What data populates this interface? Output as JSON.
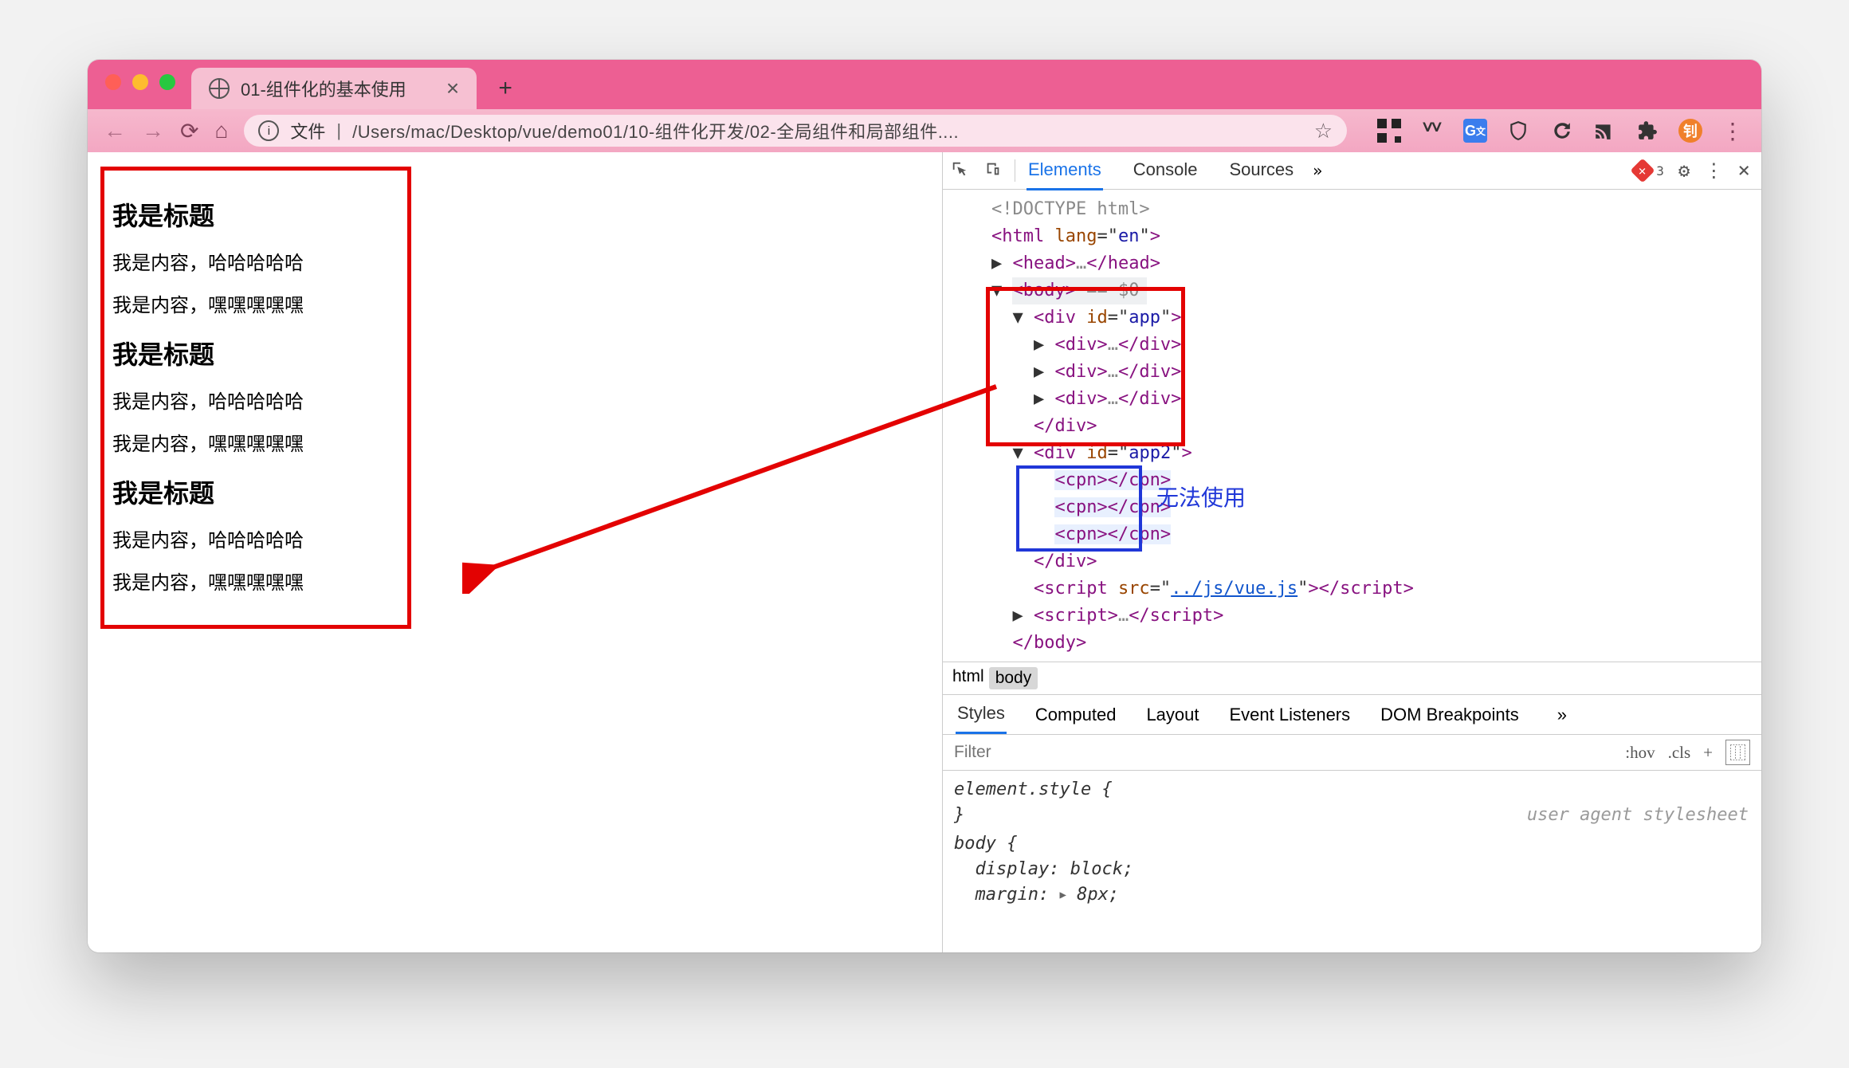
{
  "window": {
    "tab_title": "01-组件化的基本使用",
    "url_prefix": "文件",
    "url_path": "/Users/mac/Desktop/vue/demo01/10-组件化开发/02-全局组件和局部组件....",
    "avatar_initial": "钊"
  },
  "page": {
    "blocks": [
      {
        "title": "我是标题",
        "lines": [
          "我是内容，哈哈哈哈哈",
          "我是内容，嘿嘿嘿嘿嘿"
        ]
      },
      {
        "title": "我是标题",
        "lines": [
          "我是内容，哈哈哈哈哈",
          "我是内容，嘿嘿嘿嘿嘿"
        ]
      },
      {
        "title": "我是标题",
        "lines": [
          "我是内容，哈哈哈哈哈",
          "我是内容，嘿嘿嘿嘿嘿"
        ]
      }
    ]
  },
  "devtools": {
    "tabs": [
      "Elements",
      "Console",
      "Sources"
    ],
    "active_tab": "Elements",
    "error_count": "3",
    "dom_lines": [
      {
        "indent": 0,
        "pre": "",
        "html": "<span class='gray'>&lt;!DOCTYPE html&gt;</span>"
      },
      {
        "indent": 0,
        "pre": "",
        "html": "<span class='tag-p'>&lt;html</span> <span class='tag-a'>lang</span>=\"<span class='tag-v'>en</span>\"<span class='tag-p'>&gt;</span>"
      },
      {
        "indent": 1,
        "pre": "▶",
        "html": "<span class='tag-p'>&lt;head&gt;</span><span class='gray'>…</span><span class='tag-p'>&lt;/head&gt;</span>"
      },
      {
        "indent": 1,
        "pre": "▼",
        "html": "<span class='bodyhl'><span class='tag-p'>&lt;body&gt;</span> <span class='gray'>== $0</span></span>",
        "dots": true
      },
      {
        "indent": 2,
        "pre": "▼",
        "html": "<span class='tag-p'>&lt;div</span> <span class='tag-a'>id</span>=\"<span class='tag-v'>app</span>\"<span class='tag-p'>&gt;</span>"
      },
      {
        "indent": 3,
        "pre": "▶",
        "html": "<span class='tag-p'>&lt;div&gt;</span><span class='gray'>…</span><span class='tag-p'>&lt;/div&gt;</span>"
      },
      {
        "indent": 3,
        "pre": "▶",
        "html": "<span class='tag-p'>&lt;div&gt;</span><span class='gray'>…</span><span class='tag-p'>&lt;/div&gt;</span>"
      },
      {
        "indent": 3,
        "pre": "▶",
        "html": "<span class='tag-p'>&lt;div&gt;</span><span class='gray'>…</span><span class='tag-p'>&lt;/div&gt;</span>"
      },
      {
        "indent": 2,
        "pre": "",
        "html": "<span class='tag-p'>&lt;/div&gt;</span>"
      },
      {
        "indent": 2,
        "pre": "▼",
        "html": "<span class='tag-p'>&lt;div</span> <span class='tag-a'>id</span>=\"<span class='tag-v'>app2</span>\"<span class='tag-p'>&gt;</span>"
      },
      {
        "indent": 3,
        "pre": "",
        "html": "<span class='hl'><span class='tag-p'>&lt;cpn&gt;&lt;/cpn&gt;</span></span>"
      },
      {
        "indent": 3,
        "pre": "",
        "html": "<span class='hl'><span class='tag-p'>&lt;cpn&gt;&lt;/cpn&gt;</span></span>"
      },
      {
        "indent": 3,
        "pre": "",
        "html": "<span class='hl'><span class='tag-p'>&lt;cpn&gt;&lt;/cpn&gt;</span></span>"
      },
      {
        "indent": 2,
        "pre": "",
        "html": "<span class='tag-p'>&lt;/div&gt;</span>"
      },
      {
        "indent": 2,
        "pre": "",
        "html": "<span class='tag-p'>&lt;script</span> <span class='tag-a'>src</span>=\"<span class='link'>../js/vue.js</span>\"<span class='tag-p'>&gt;&lt;/script&gt;</span>"
      },
      {
        "indent": 2,
        "pre": "▶",
        "html": "<span class='tag-p'>&lt;script&gt;</span><span class='gray'>…</span><span class='tag-p'>&lt;/script&gt;</span>"
      },
      {
        "indent": 1,
        "pre": "",
        "html": "<span class='tag-p'>&lt;/body&gt;</span>"
      }
    ],
    "cannot_use_label": "无法使用",
    "breadcrumbs": [
      "html",
      "body"
    ],
    "style_tabs": [
      "Styles",
      "Computed",
      "Layout",
      "Event Listeners",
      "DOM Breakpoints"
    ],
    "active_style_tab": "Styles",
    "filter_placeholder": "Filter",
    "filter_opts": [
      ":hov",
      ".cls",
      "+"
    ],
    "css_block": {
      "element_style": "element.style {",
      "close": "}",
      "body_sel": "body {",
      "props": [
        {
          "k": "display",
          "v": "block;"
        },
        {
          "k": "margin",
          "v": "8px;",
          "tri": true
        }
      ],
      "ua_label": "user agent stylesheet"
    }
  }
}
